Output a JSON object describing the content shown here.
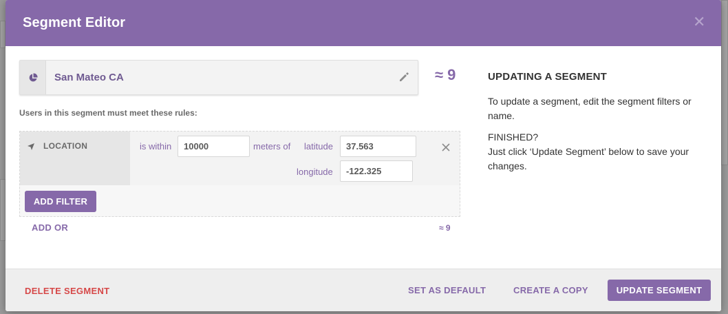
{
  "modal": {
    "title": "Segment Editor",
    "close_icon": "close-icon"
  },
  "segment": {
    "name": "San Mateo CA",
    "icon": "pie-chart-icon",
    "edit_icon": "pencil-icon",
    "count": "≈ 9"
  },
  "rules": {
    "label": "Users in this segment must meet these rules:",
    "filters": [
      {
        "type_icon": "location-arrow-icon",
        "type_label": "LOCATION",
        "operator": "is within",
        "distance": "10000",
        "unit": "meters of",
        "latitude_label": "latitude",
        "latitude": "37.563",
        "longitude_label": "longitude",
        "longitude": "-122.325",
        "remove_icon": "close-icon"
      }
    ],
    "add_filter_label": "ADD FILTER",
    "add_or_label": "ADD OR",
    "group_count": "≈ 9"
  },
  "help": {
    "title": "UPDATING A SEGMENT",
    "text": "To update a segment, edit the segment filters or name.",
    "finished_title": "FINISHED?",
    "finished_text": "Just click ‘Update Segment’ below to save your changes."
  },
  "footer": {
    "delete_label": "DELETE SEGMENT",
    "default_label": "SET AS DEFAULT",
    "copy_label": "CREATE A COPY",
    "update_label": "UPDATE SEGMENT"
  },
  "colors": {
    "accent": "#8669a9",
    "danger": "#d64848"
  }
}
